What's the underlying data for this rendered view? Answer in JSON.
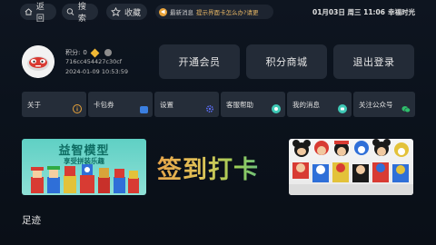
{
  "topbar": {
    "back_label": "返回",
    "search_label": "搜索",
    "favorites_label": "收藏",
    "news_label": "最新消息",
    "news_text": "提示界面卡怎么办?请更",
    "date_time": "01月03日 周三 11:06",
    "brand": "幸福时光"
  },
  "profile": {
    "points_label": "积分:",
    "points_value": "0",
    "user_id": "716cc454427c30cf",
    "timestamp": "2024-01-09 10:53:59"
  },
  "actions": {
    "vip_label": "开通会员",
    "points_mall_label": "积分商城",
    "logout_label": "退出登录"
  },
  "menu": {
    "about": "关于",
    "card_wallet": "卡包券",
    "settings": "设置",
    "customer_help": "客服帮助",
    "my_messages": "我的消息",
    "follow_account": "关注公众号"
  },
  "banners": {
    "left_title": "益智模型",
    "left_subtitle": "享受拼装乐趣",
    "signin_text": "签到打卡"
  },
  "sections": {
    "footprint": "足迹"
  },
  "colors": {
    "accent_orange": "#e9a33a",
    "accent_green": "#3fae9e",
    "button_bg": "#232b37",
    "page_bg": "#0b121c"
  }
}
